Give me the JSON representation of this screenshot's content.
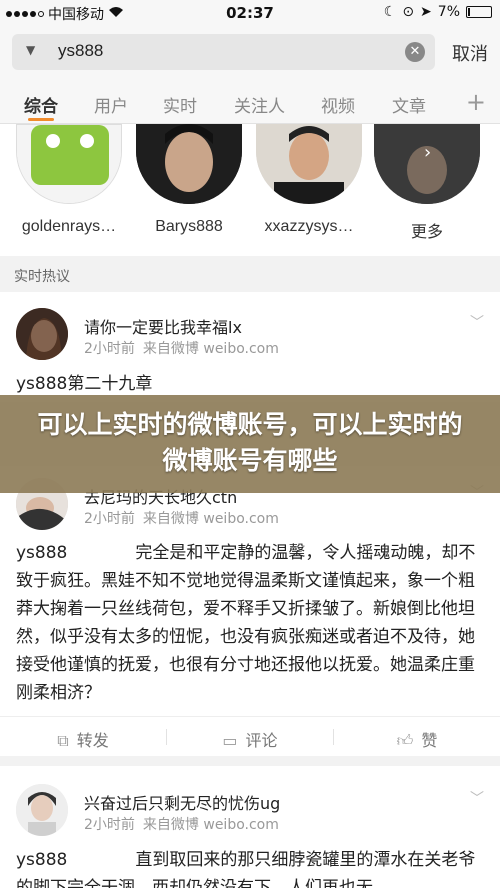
{
  "status_bar": {
    "carrier": "中国移动",
    "time": "02:37",
    "battery": "7%",
    "battery_level": 0.07
  },
  "search": {
    "query": "ys888",
    "cancel_label": "取消"
  },
  "tabs": [
    {
      "label": "综合"
    },
    {
      "label": "用户"
    },
    {
      "label": "实时"
    },
    {
      "label": "关注人"
    },
    {
      "label": "视频"
    },
    {
      "label": "文章"
    }
  ],
  "users": [
    {
      "name": "goldenrays…"
    },
    {
      "name": "Barys888"
    },
    {
      "name": "xxazzysys…"
    },
    {
      "name": "更多"
    }
  ],
  "section_label": "实时热议",
  "posts": [
    {
      "author": "请你一定要比我幸福lx",
      "time": "2小时前",
      "source": "来自微博 weibo.com",
      "text": "ys888第二十九章"
    },
    {
      "author": "去尼玛的天长地久ctn",
      "time": "2小时前",
      "source": "来自微博 weibo.com",
      "text": "ys888　　　　完全是和平定静的温馨，令人摇魂动魄，却不致于疯狂。黑娃不知不觉地觉得温柔斯文谨慎起来，象一个粗莽大掬着一只丝线荷包，爱不释手又折揉皱了。新娘倒比他坦然，似乎没有太多的忸怩，也没有疯张痴迷或者迫不及待，她接受他谨慎的抚爱，也很有分寸地还报他以抚爱。她温柔庄重刚柔相济？",
      "actions": {
        "repost": "转发",
        "comment": "评论",
        "like": "赞"
      }
    },
    {
      "author": "兴奋过后只剩无尽的忧伤ug",
      "time": "2小时前",
      "source": "来自微博 weibo.com",
      "text": "ys888　　　　直到取回来的那只细脖瓷罐里的潭水在关老爷的脚下完全干涸，西却仍然没有下，人们再也无"
    }
  ],
  "banner": "可以上实时的微博账号，可以上实时的微博账号有哪些"
}
